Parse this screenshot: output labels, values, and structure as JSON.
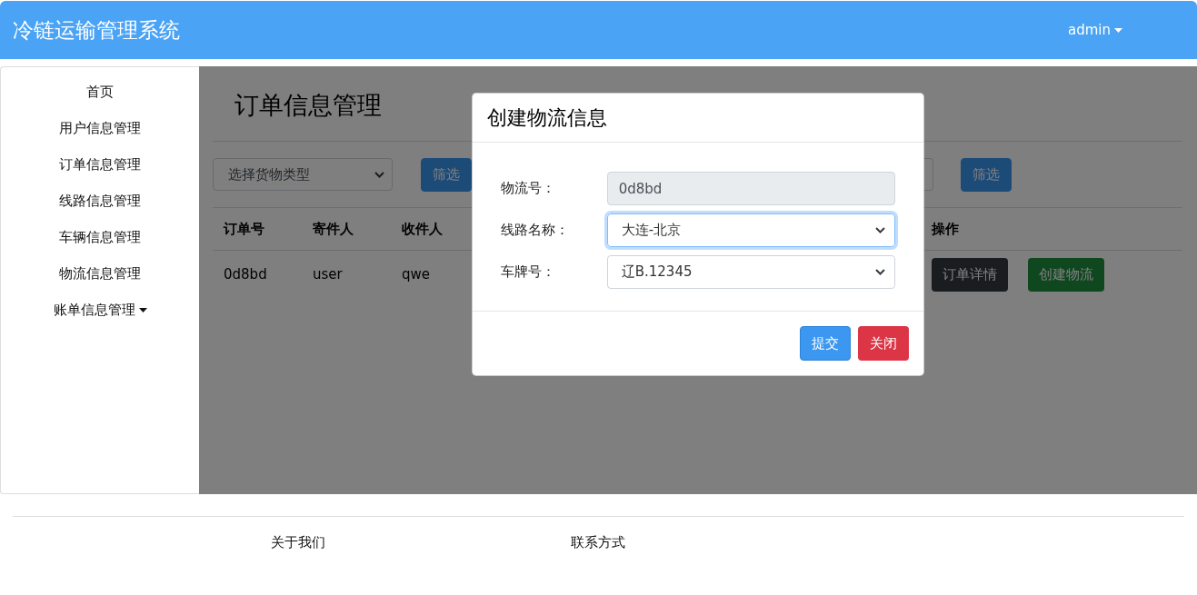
{
  "header": {
    "title": "冷链运输管理系统",
    "user_menu": "admin"
  },
  "sidebar": {
    "items": [
      {
        "label": "首页",
        "dropdown": false
      },
      {
        "label": "用户信息管理",
        "dropdown": false
      },
      {
        "label": "订单信息管理",
        "dropdown": false
      },
      {
        "label": "线路信息管理",
        "dropdown": false
      },
      {
        "label": "车辆信息管理",
        "dropdown": false
      },
      {
        "label": "物流信息管理",
        "dropdown": false
      },
      {
        "label": "账单信息管理",
        "dropdown": true
      }
    ]
  },
  "page": {
    "title": "订单信息管理",
    "filters": [
      {
        "kind": "select",
        "placeholder": "选择货物类型"
      },
      {
        "kind": "button",
        "label": "筛选"
      },
      {
        "kind": "input"
      },
      {
        "kind": "button",
        "label": "筛选"
      }
    ],
    "table": {
      "columns": [
        "订单号",
        "寄件人",
        "收件人",
        "操作"
      ],
      "rows": [
        {
          "cells": [
            "0d8bd",
            "user",
            "qwe"
          ],
          "actions": [
            {
              "label": "订单详情",
              "kind": "secondary"
            },
            {
              "label": "创建物流",
              "kind": "success"
            }
          ]
        }
      ]
    }
  },
  "modal": {
    "title": "创建物流信息",
    "fields": [
      {
        "label": "物流号：",
        "kind": "readonly",
        "value": "0d8bd",
        "focused": false
      },
      {
        "label": "线路名称：",
        "kind": "select",
        "value": "大连-北京",
        "focused": true
      },
      {
        "label": "车牌号：",
        "kind": "select",
        "value": "辽B.12345",
        "focused": false
      }
    ],
    "buttons": [
      {
        "label": "提交",
        "kind": "primary"
      },
      {
        "label": "关闭",
        "kind": "danger"
      }
    ]
  },
  "footer": {
    "links": [
      "关于我们",
      "联系方式"
    ]
  }
}
